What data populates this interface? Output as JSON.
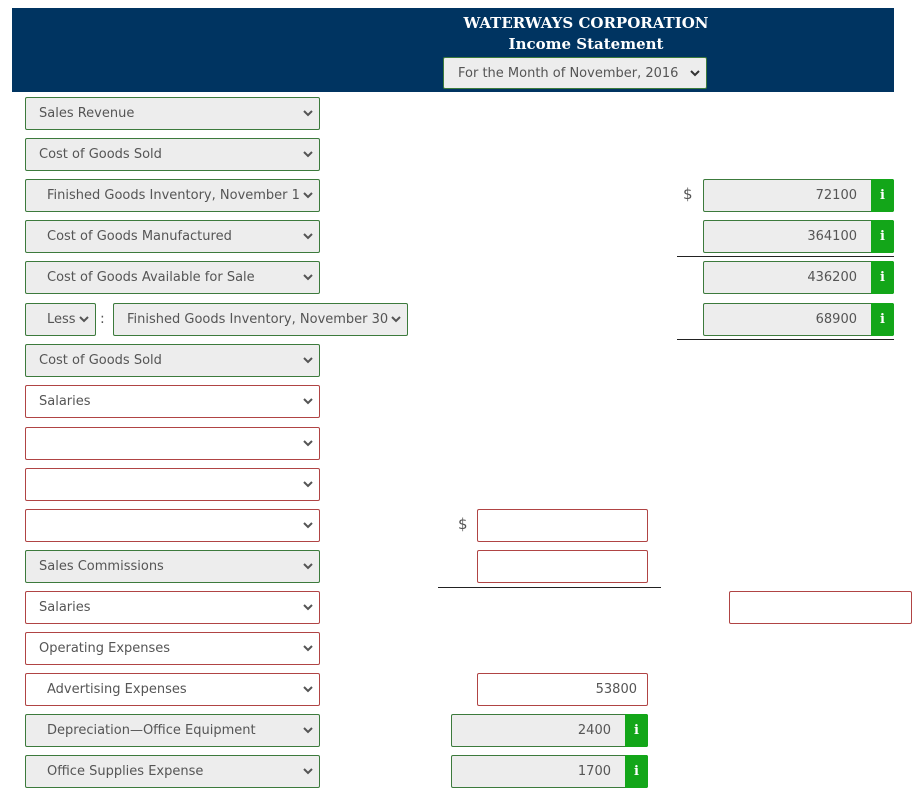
{
  "header": {
    "company": "WATERWAYS CORPORATION",
    "title": "Income Statement",
    "period": "For the Month of November, 2016",
    "bg_color": "#003461"
  },
  "rows": {
    "sales_revenue": "Sales Revenue",
    "cogs_heading": "Cost of Goods Sold",
    "fg_inv_nov1": "Finished Goods Inventory, November 1",
    "cogm": "Cost of Goods Manufactured",
    "cogas": "Cost of Goods Available for Sale",
    "less": "Less",
    "fg_inv_nov30": "Finished Goods Inventory, November 30",
    "cogs_total": "Cost of Goods Sold",
    "salaries_1": "Salaries",
    "blank_1": "",
    "blank_2": "",
    "blank_3": "",
    "sales_commissions": "Sales Commissions",
    "salaries_2": "Salaries",
    "operating_expenses": "Operating Expenses",
    "advertising": "Advertising Expenses",
    "depreciation": "Depreciation—Office Equipment",
    "office_supplies": "Office Supplies Expense"
  },
  "values": {
    "fg_inv_nov1": "72100",
    "cogm": "364100",
    "cogas": "436200",
    "fg_inv_nov30": "68900",
    "blank_3_amount": "",
    "sales_commissions_amount": "",
    "salaries_2_total": "",
    "advertising": "53800",
    "depreciation": "2400",
    "office_supplies": "1700"
  },
  "symbols": {
    "dollar": "$",
    "colon": ":",
    "info": "i"
  },
  "colors": {
    "correct_border": "#3c7a3c",
    "incorrect_border": "#b04444",
    "info_badge": "#13a619"
  }
}
